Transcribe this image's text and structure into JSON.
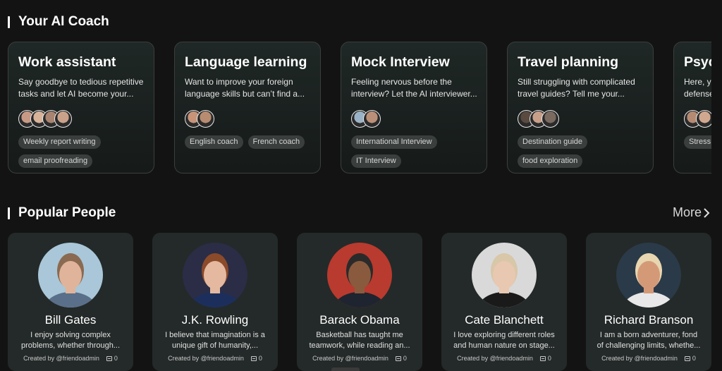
{
  "coach_section": {
    "title": "Your AI Coach",
    "cards": [
      {
        "name": "Work assistant",
        "description": "Say goodbye to tedious repetitive tasks and let AI become your...",
        "avatars": [
          "#c89a85",
          "#d7b39a",
          "#a98470",
          "#caa28a"
        ],
        "tags": [
          "Weekly report writing",
          "email proofreading"
        ]
      },
      {
        "name": "Language learning",
        "description": "Want to improve your foreign language skills but can’t find a...",
        "avatars": [
          "#c79479",
          "#b88c70"
        ],
        "tags": [
          "English coach",
          "French coach"
        ]
      },
      {
        "name": "Mock Interview",
        "description": "Feeling nervous before the interview? Let the AI interviewer...",
        "avatars": [
          "#9bb3c6",
          "#bb9078"
        ],
        "tags": [
          "International Interview",
          "IT Interview"
        ]
      },
      {
        "name": "Travel planning",
        "description": "Still struggling with complicated travel guides? Tell me your...",
        "avatars": [
          "#5a4a40",
          "#c8a08a",
          "#7a6a60"
        ],
        "tags": [
          "Destination guide",
          "food exploration"
        ]
      },
      {
        "name": "Psychological",
        "description": "Here, you can let down your defenses...",
        "avatars": [
          "#b48a72",
          "#d0a890"
        ],
        "tags": [
          "Stress management"
        ]
      }
    ]
  },
  "popular_section": {
    "title": "Popular People",
    "more_label": "More",
    "people": [
      {
        "name": "Bill Gates",
        "description": "I enjoy solving complex problems, whether through...",
        "created_by": "Created by @friendoadmin",
        "count": "0",
        "photo_bg": "#a9c7d8",
        "skin": "#e0b49a",
        "hair": "#8a6a50",
        "shirt": "#5a6f8a"
      },
      {
        "name": "J.K. Rowling",
        "description": "I believe that imagination is a unique gift of humanity,...",
        "created_by": "Created by @friendoadmin",
        "count": "0",
        "photo_bg": "#2a2d45",
        "skin": "#e4b9a0",
        "hair": "#8b4a2a",
        "shirt": "#1c2f5c"
      },
      {
        "name": "Barack Obama",
        "description": "Basketball has taught me teamwork, while reading an...",
        "created_by": "Created by @friendoadmin",
        "count": "0",
        "photo_bg": "#b93a2e",
        "skin": "#8a5a3e",
        "hair": "#2a2a2a",
        "shirt": "#1e2430"
      },
      {
        "name": "Cate Blanchett",
        "description": "I love exploring different roles and human nature on stage...",
        "created_by": "Created by @friendoadmin",
        "count": "0",
        "photo_bg": "#d9d9d9",
        "skin": "#e8c8b0",
        "hair": "#d8c7a8",
        "shirt": "#1a1a1a"
      },
      {
        "name": "Richard Branson",
        "description": "I am a born adventurer, fond of challenging limits, whethe...",
        "created_by": "Created by @friendoadmin",
        "count": "0",
        "photo_bg": "#2a3a48",
        "skin": "#d49a78",
        "hair": "#e8d6b0",
        "shirt": "#e8e8e8"
      }
    ]
  }
}
